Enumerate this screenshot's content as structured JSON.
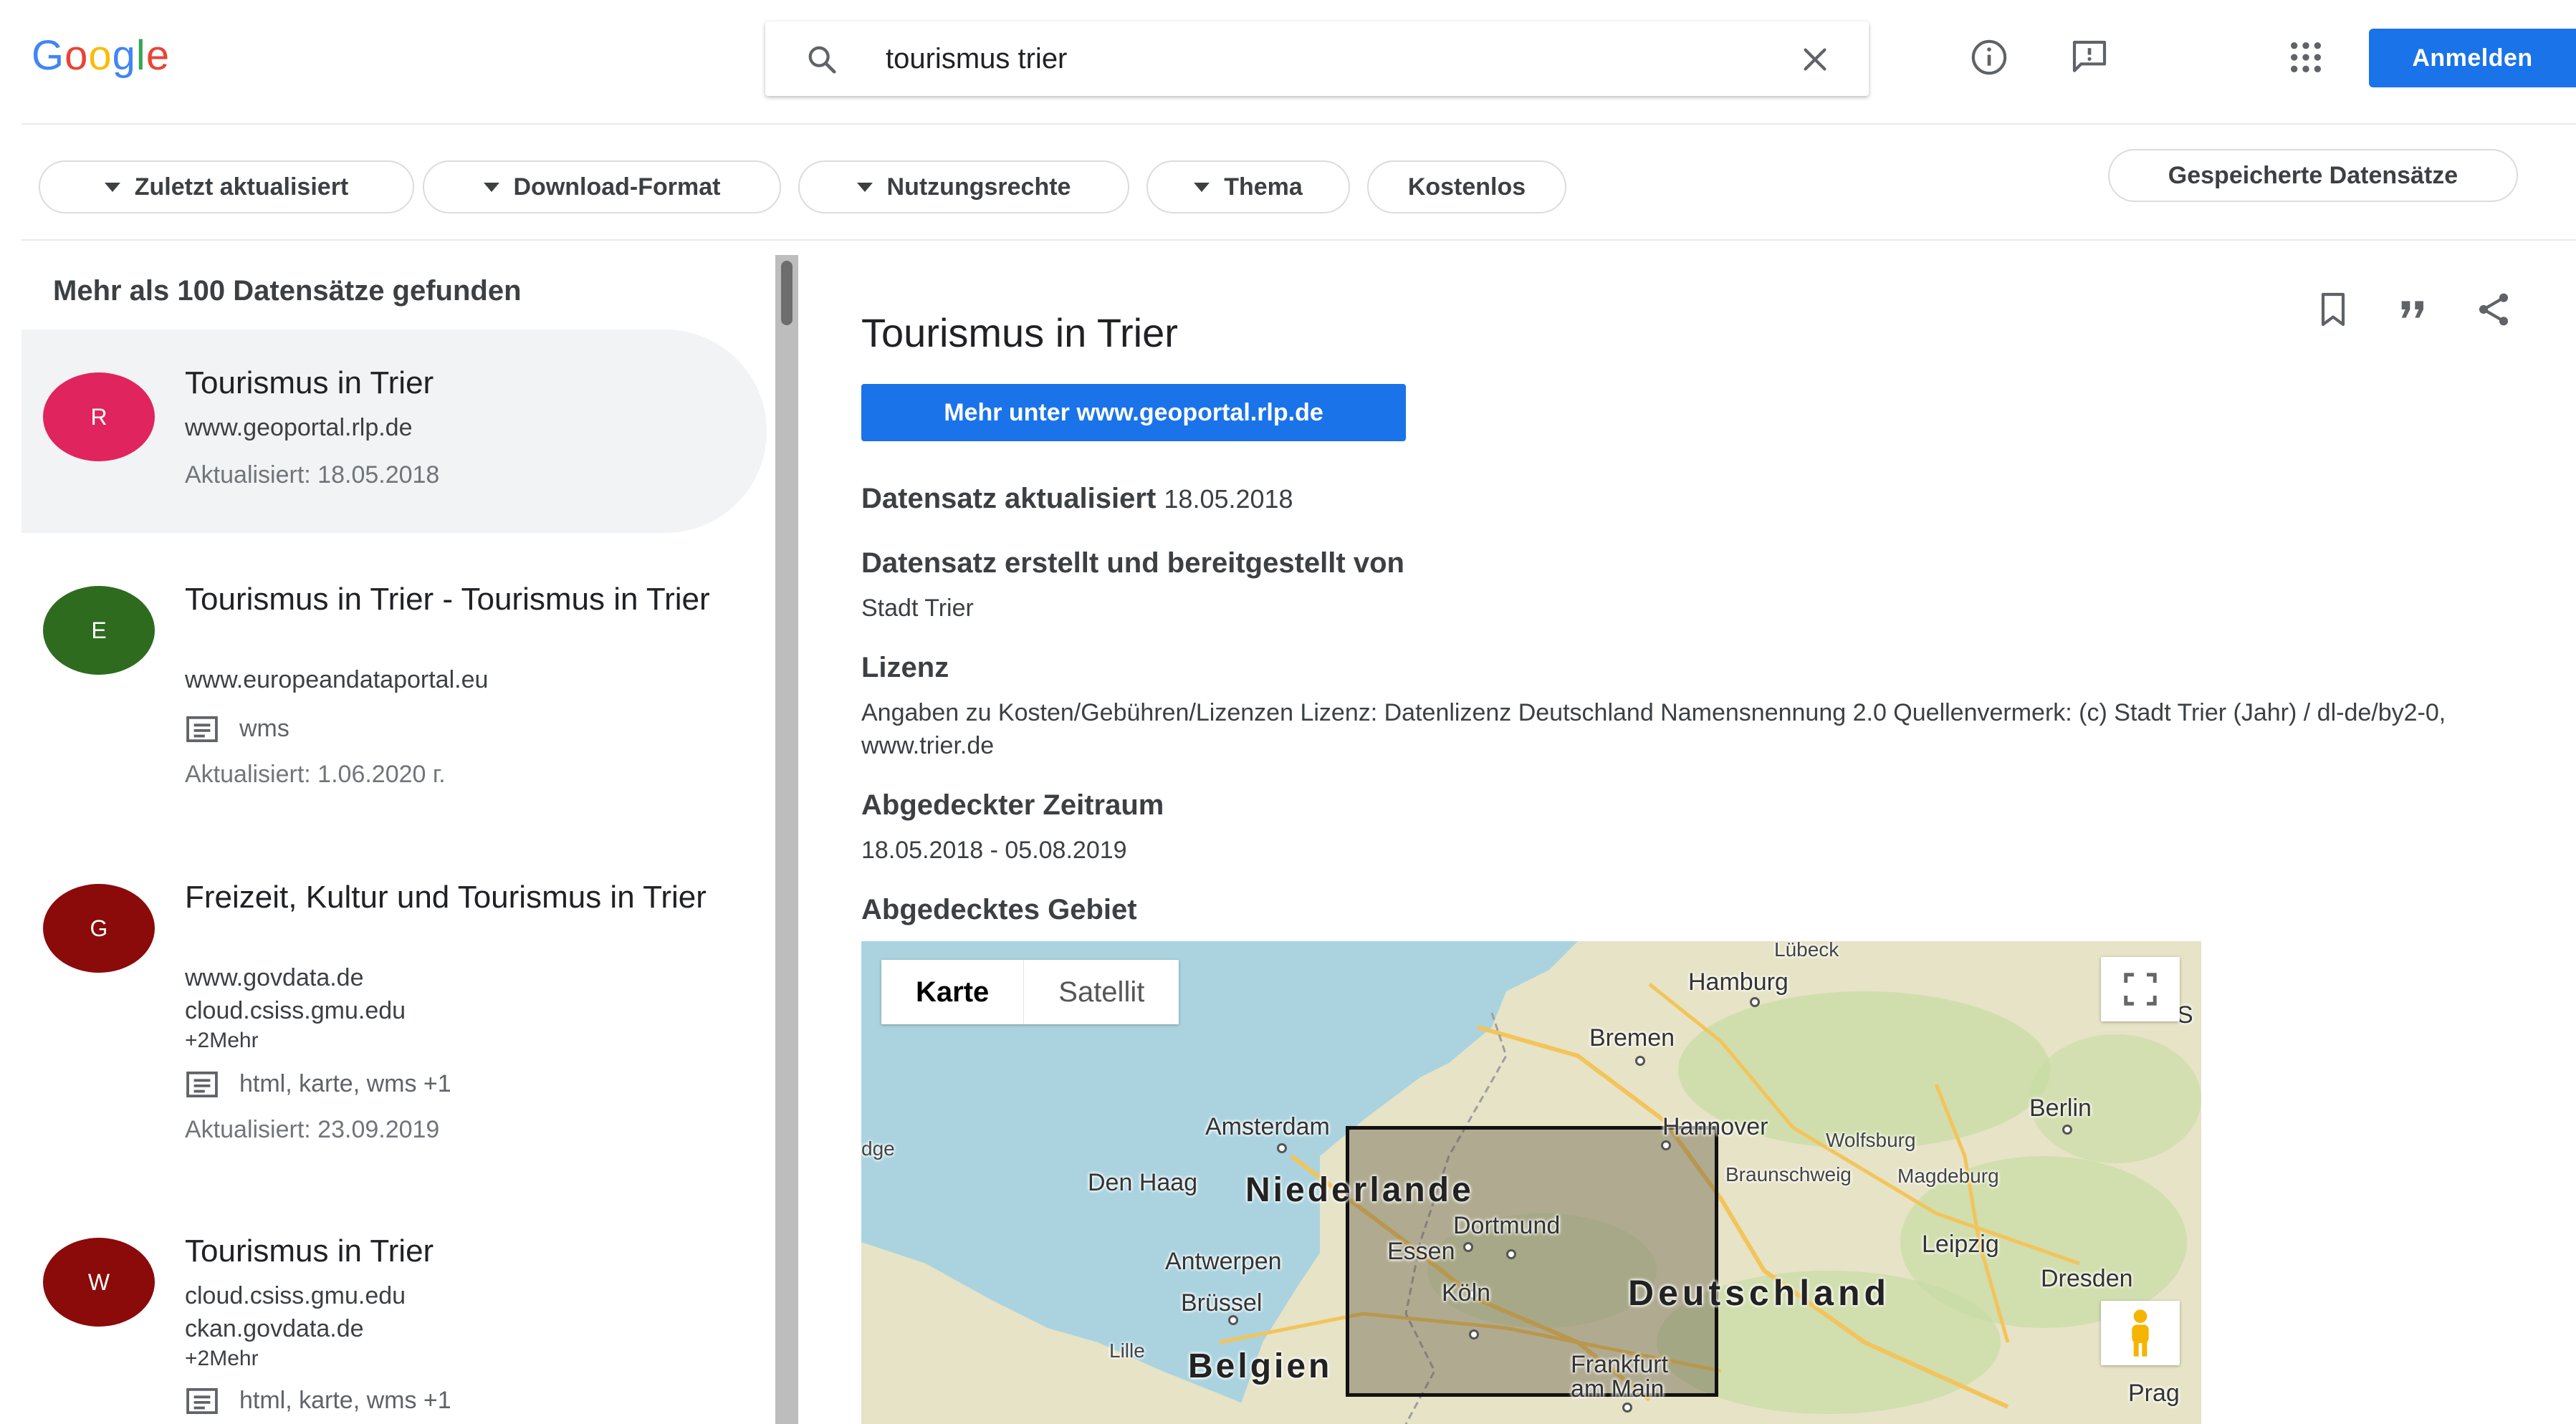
{
  "header": {
    "logo_letters": [
      {
        "ch": "G",
        "color": "#4285F4"
      },
      {
        "ch": "o",
        "color": "#EA4335"
      },
      {
        "ch": "o",
        "color": "#FBBC05"
      },
      {
        "ch": "g",
        "color": "#4285F4"
      },
      {
        "ch": "l",
        "color": "#34A853"
      },
      {
        "ch": "e",
        "color": "#EA4335"
      }
    ],
    "search_value": "tourismus trier",
    "icons": [
      "search-icon",
      "clear-icon",
      "info-icon",
      "feedback-icon",
      "apps-icon"
    ],
    "signin_label": "Anmelden",
    "accent": "#1a73e8"
  },
  "filters": {
    "chips": [
      {
        "label": "Zuletzt aktualisiert",
        "dropdown": true
      },
      {
        "label": "Download-Format",
        "dropdown": true
      },
      {
        "label": "Nutzungsrechte",
        "dropdown": true
      },
      {
        "label": "Thema",
        "dropdown": true
      },
      {
        "label": "Kostenlos",
        "dropdown": false
      }
    ],
    "saved_label": "Gespeicherte Datensätze"
  },
  "results": {
    "count_text": "Mehr als 100 Datensätze gefunden",
    "items": [
      {
        "avatar_letter": "R",
        "avatar_color": "#e0245e",
        "title": "Tourismus in Trier",
        "sources": [
          "www.geoportal.rlp.de"
        ],
        "more": "",
        "formats": "",
        "updated": "Aktualisiert: 18.05.2018"
      },
      {
        "avatar_letter": "E",
        "avatar_color": "#2e6b1f",
        "title": "Tourismus in Trier - Tourismus in Trier",
        "sources": [
          "www.europeandataportal.eu"
        ],
        "more": "",
        "formats": "wms",
        "updated": "Aktualisiert: 1.06.2020 г."
      },
      {
        "avatar_letter": "G",
        "avatar_color": "#8b0a0a",
        "title": "Freizeit, Kultur und Tourismus in Trier",
        "sources": [
          "www.govdata.de",
          "cloud.csiss.gmu.edu"
        ],
        "more": "+2Mehr",
        "formats": "html, karte, wms +1",
        "updated": "Aktualisiert: 23.09.2019"
      },
      {
        "avatar_letter": "W",
        "avatar_color": "#8b0a0a",
        "title": "Tourismus in Trier",
        "sources": [
          "cloud.csiss.gmu.edu",
          "ckan.govdata.de"
        ],
        "more": "+2Mehr",
        "formats": "html, karte, wms +1",
        "updated": ""
      }
    ]
  },
  "detail": {
    "title": "Tourismus in Trier",
    "actions": [
      "bookmark-icon",
      "cite-icon",
      "share-icon"
    ],
    "more_button": "Mehr unter www.geoportal.rlp.de",
    "updated_label": "Datensatz aktualisiert",
    "updated_value": "18.05.2018",
    "created_label": "Datensatz erstellt und bereitgestellt von",
    "created_value": "Stadt Trier",
    "license_label": "Lizenz",
    "license_value": "Angaben zu Kosten/Gebühren/Lizenzen Lizenz: Datenlizenz Deutschland Namensnennung 2.0 Quellenvermerk: (c) Stadt Trier (Jahr) / dl-de/by2-0, www.trier.de",
    "period_label": "Abgedeckter Zeitraum",
    "period_value": "18.05.2018 - 05.08.2019",
    "area_label": "Abgedecktes Gebiet"
  },
  "map": {
    "toggle_map": "Karte",
    "toggle_satellite": "Satellit",
    "labels": {
      "luebeck": "Lübeck",
      "hamburg": "Hamburg",
      "bremen": "Bremen",
      "berlin": "Berlin",
      "amsterdam": "Amsterdam",
      "hannover": "Hannover",
      "wolfsburg": "Wolfsburg",
      "braunschweig": "Braunschweig",
      "magdeburg": "Magdeburg",
      "denhaag": "Den Haag",
      "niederlande": "Niederlande",
      "dortmund": "Dortmund",
      "essen": "Essen",
      "antwerpen": "Antwerpen",
      "leipzig": "Leipzig",
      "dresden": "Dresden",
      "bruessel": "Brüssel",
      "koeln": "Köln",
      "deutschland": "Deutschland",
      "lille": "Lille",
      "belgien": "Belgien",
      "frankfurt": "Frankfurt",
      "ammain": "am Main",
      "prag": "Prag",
      "edge": "dge",
      "s": "S"
    },
    "colors": {
      "water": "#aad3df",
      "land": "#e6e3c6",
      "green": "#c8dca4"
    }
  }
}
